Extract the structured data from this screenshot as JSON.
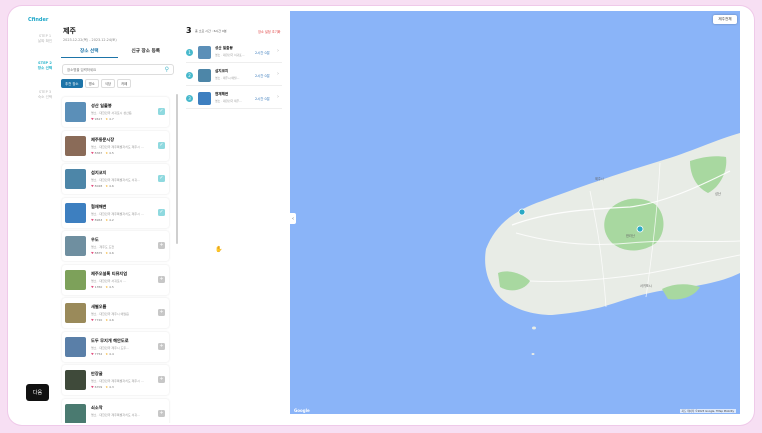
{
  "logo": "Cfinder",
  "steps": [
    {
      "n": "STEP 1",
      "label": "날짜 확인",
      "active": false
    },
    {
      "n": "STEP 2",
      "label": "장소 선택",
      "active": true
    },
    {
      "n": "STEP 3",
      "label": "숙소 선택",
      "active": false
    }
  ],
  "next_label": "다음",
  "header": {
    "city": "제주",
    "dates": "2023.12.22(목) - 2023.12.24(토)"
  },
  "tabs": [
    {
      "label": "장소 선택",
      "active": true
    },
    {
      "label": "신규 장소 등록",
      "active": false
    }
  ],
  "search": {
    "placeholder": "장소명을 입력하세요"
  },
  "chips": [
    {
      "label": "추천 장소",
      "active": true
    },
    {
      "label": "명소",
      "active": false
    },
    {
      "label": "식당",
      "active": false
    },
    {
      "label": "카페",
      "active": false
    }
  ],
  "places": [
    {
      "name": "성산 일출봉",
      "addr": "명소 · 대한민국 서귀포시 성산읍",
      "likes": "9617",
      "rating": "4.7",
      "selected": true,
      "thumb": "#5b8fb8"
    },
    {
      "name": "제주동문시장",
      "addr": "명소 · 대한민국 제주특별자치도 제주시 …",
      "likes": "8367",
      "rating": "4.5",
      "selected": true,
      "thumb": "#8a6b58"
    },
    {
      "name": "섭지코지",
      "addr": "명소 · 대한민국 제주특별자치도 서귀…",
      "likes": "8028",
      "rating": "4.6",
      "selected": true,
      "thumb": "#4d86a8"
    },
    {
      "name": "협재해변",
      "addr": "명소 · 대한민국 제주특별자치도 제주시 …",
      "likes": "8963",
      "rating": "4.2",
      "selected": true,
      "thumb": "#3d7fc0"
    },
    {
      "name": "우도",
      "addr": "명소 · 제주도 도전",
      "likes": "8875",
      "rating": "4.6",
      "selected": false,
      "thumb": "#6f8fa0"
    },
    {
      "name": "제주오설록 티뮤지엄",
      "addr": "명소 · 대한민국 서귀포시 …",
      "likes": "1350",
      "rating": "4.5",
      "selected": false,
      "thumb": "#7da15a"
    },
    {
      "name": "새별오름",
      "addr": "명소 · 대한민국 제주시 애월읍",
      "likes": "7720",
      "rating": "4.6",
      "selected": false,
      "thumb": "#9a8a5a"
    },
    {
      "name": "도두 무지개 해안도로",
      "addr": "명소 · 대한민국 제주시 도두…",
      "likes": "7752",
      "rating": "4.4",
      "selected": false,
      "thumb": "#5a7fa8"
    },
    {
      "name": "만장굴",
      "addr": "명소 · 대한민국 제주특별자치도 제주시 …",
      "likes": "6709",
      "rating": "4.3",
      "selected": false,
      "thumb": "#3f4a3a"
    },
    {
      "name": "쇠소깍",
      "addr": "명소 · 대한민국 제주특별자치도 서귀…",
      "likes": "",
      "rating": "",
      "selected": false,
      "thumb": "#4a7a70"
    }
  ],
  "selected": {
    "count": "3",
    "duration": "총 소요 시간 : 6시간 0분",
    "reset": "장소 설정 초기화",
    "items": [
      {
        "num": "1",
        "title": "성산 일출봉",
        "addr": "명소 · 대한민국 서귀포…",
        "time": "2시간 0분",
        "thumb": "#5b8fb8"
      },
      {
        "num": "2",
        "title": "섭지코지",
        "addr": "명소 · 제주시 애월…",
        "time": "2시간 0분",
        "thumb": "#4d86a8"
      },
      {
        "num": "3",
        "title": "협재해변",
        "addr": "명소 · 대한민국 제주…",
        "time": "2시간 0분",
        "thumb": "#3d7fc0"
      }
    ]
  },
  "map": {
    "button": "제주전체",
    "collapse_icon": "chevron-left-icon",
    "google": "Google",
    "attribution": "지도 데이터 ©2023 Google, TMap Mobility",
    "labels": [
      "제주시",
      "한라산",
      "서귀포시",
      "성산"
    ],
    "colors": {
      "sea": "#8ab4f8",
      "land": "#e8ece6",
      "park": "#a8d8a0",
      "marker": "#2aa9c5"
    }
  }
}
